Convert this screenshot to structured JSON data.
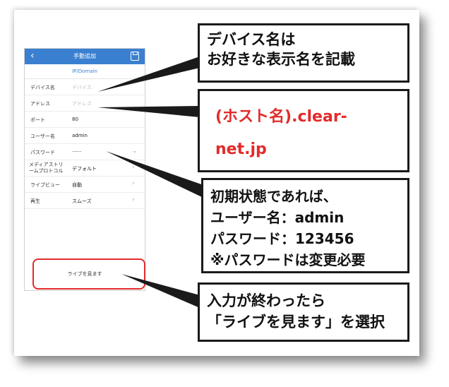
{
  "app": {
    "title": "手動追加",
    "back_icon": "‹",
    "subtab": "IP/Domain"
  },
  "form": [
    {
      "label": "デバイス名",
      "value": "デバイス",
      "placeholder": true,
      "chevron": false
    },
    {
      "label": "アドレス",
      "value": "アドレス",
      "placeholder": true,
      "chevron": false
    },
    {
      "label": "ポート",
      "value": "80",
      "placeholder": false,
      "chevron": false
    },
    {
      "label": "ユーザー名",
      "value": "admin",
      "placeholder": false,
      "chevron": false
    },
    {
      "label": "パスワード",
      "value": "······",
      "placeholder": false,
      "chevron": true
    },
    {
      "label": "メディアストリームプロトコル",
      "label_lines": [
        "メディアストリ",
        "ームプロトコル"
      ],
      "value": "デフォルト",
      "placeholder": false,
      "chevron": true
    },
    {
      "label": "ライブビュー",
      "value": "自動",
      "placeholder": false,
      "chevron": true
    },
    {
      "label": "再生",
      "value": "スムーズ",
      "placeholder": false,
      "chevron": true
    }
  ],
  "live_button": "ライブを見ます",
  "callouts": {
    "device_name": [
      "デバイス名は",
      "お好きな表示名を記載"
    ],
    "address": [
      "(ホスト名).clear-",
      "net.jp"
    ],
    "credentials": [
      "初期状態であれば、",
      "ユーザー名：admin",
      "パスワード：123456",
      "※パスワードは変更必要"
    ],
    "finish": [
      "入力が終わったら",
      "「ライブを見ます」を選択"
    ]
  },
  "colors": {
    "appbar": "#3b80d0",
    "highlight": "#e32b2b"
  }
}
